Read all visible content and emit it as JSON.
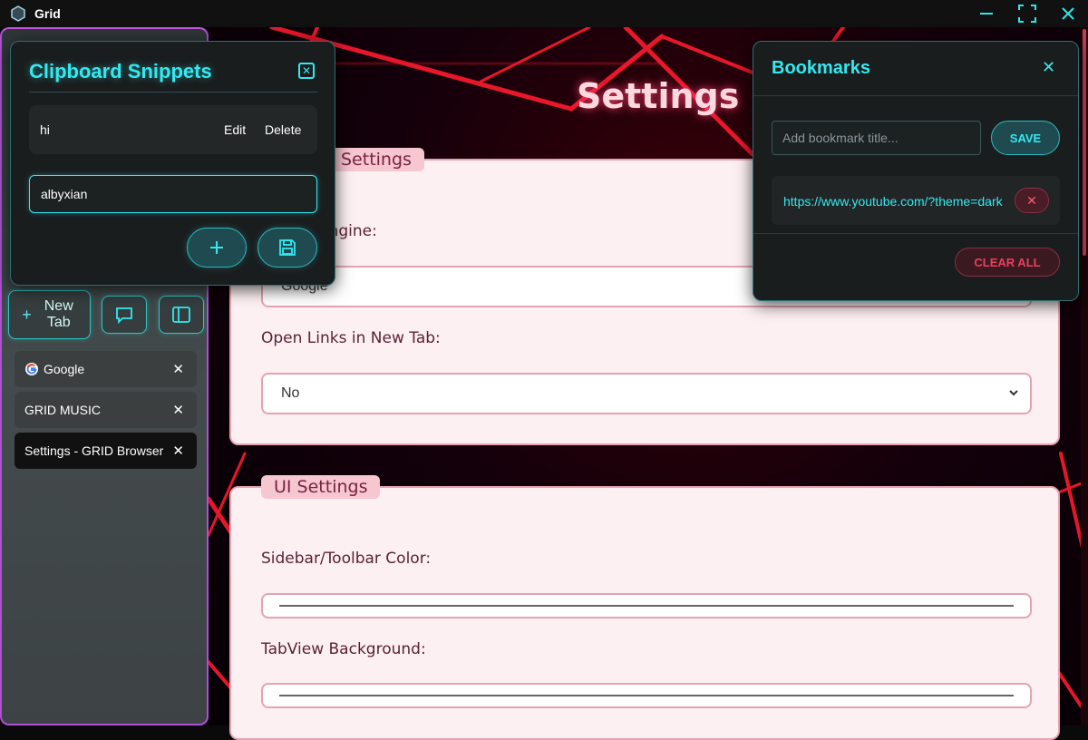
{
  "window": {
    "title": "Grid"
  },
  "page": {
    "heading": "Settings"
  },
  "settings_card": {
    "legend": "Settings",
    "search_engine_label": "Search Engine:",
    "search_engine_value": "Google",
    "open_links_label": "Open Links in New Tab:",
    "open_links_value": "No"
  },
  "ui_card": {
    "legend": "UI Settings",
    "sidebar_color_label": "Sidebar/Toolbar Color:",
    "tabview_bg_label": "TabView Background:"
  },
  "sidebar": {
    "new_tab_label": "New Tab",
    "tabs": [
      {
        "label": "Google",
        "close": "✕"
      },
      {
        "label": "GRID MUSIC",
        "close": "✕"
      },
      {
        "label": "Settings - GRID Browser",
        "close": "✕"
      }
    ]
  },
  "snippets": {
    "title": "Clipboard Snippets",
    "items": [
      {
        "text": "hi",
        "edit": "Edit",
        "delete": "Delete"
      }
    ],
    "input_value": "albyxian"
  },
  "bookmarks": {
    "title": "Bookmarks",
    "input_placeholder": "Add bookmark title...",
    "save_label": "SAVE",
    "items": [
      {
        "url": "https://www.youtube.com/?theme=dark"
      }
    ],
    "clear_label": "CLEAR ALL"
  },
  "colors": {
    "accent": "#33e9f0",
    "danger": "#e8405e",
    "card_bg": "#fdf0f2"
  }
}
